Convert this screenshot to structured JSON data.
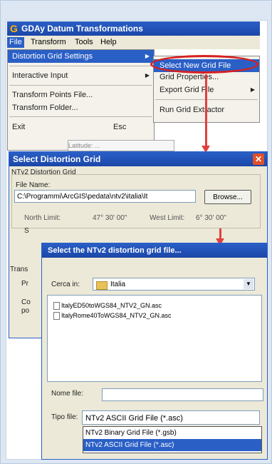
{
  "app": {
    "title": "GDAy Datum Transformations",
    "menu": [
      "File",
      "Transform",
      "Tools",
      "Help"
    ],
    "file_menu": {
      "items": [
        {
          "label": "Distortion Grid Settings",
          "submenu": true
        },
        {
          "label": "Interactive Input",
          "submenu": true
        },
        {
          "label": "Transform Points File..."
        },
        {
          "label": "Transform Folder..."
        },
        {
          "label": "Exit",
          "shortcut": "Esc"
        }
      ]
    },
    "grid_submenu": {
      "items": [
        "Select New Grid File",
        "Grid Properties...",
        "Export Grid File",
        "Run Grid Extractor"
      ]
    },
    "background_field": "Latitude: ..."
  },
  "distortion_dialog": {
    "title": "Select Distortion Grid",
    "group_label": "NTv2 Distortion Grid",
    "file_name_label": "File Name:",
    "file_path": "C:\\Programmi\\ArcGIS\\pedata\\ntv2\\italia\\It",
    "browse_label": "Browse...",
    "north_limit_label": "North Limit:",
    "north_limit_value": "47° 30' 00\"",
    "west_limit_label": "West Limit:",
    "west_limit_value": "6° 30' 00\"",
    "partial_labels": [
      "S",
      "Trans",
      "Pr",
      "Co",
      "po"
    ]
  },
  "ntv2_dialog": {
    "title": "Select the NTv2 distortion grid file...",
    "look_in_label": "Cerca in:",
    "look_in_value": "Italia",
    "files": [
      "ItalyED50toWGS84_NTV2_GN.asc",
      "ItalyRome40ToWGS84_NTV2_GN.asc"
    ],
    "file_name_label": "Nome file:",
    "file_name_value": "",
    "file_type_label": "Tipo file:",
    "file_type_value": "NTv2 ASCII Grid File (*.asc)",
    "file_type_options": [
      "NTv2 Binary Grid File (*.gsb)",
      "NTv2 ASCII Grid File (*.asc)"
    ]
  },
  "colors": {
    "titlebar": "#2a5fc6",
    "highlight_circle": "#d82020",
    "arrow": "#e04040"
  }
}
